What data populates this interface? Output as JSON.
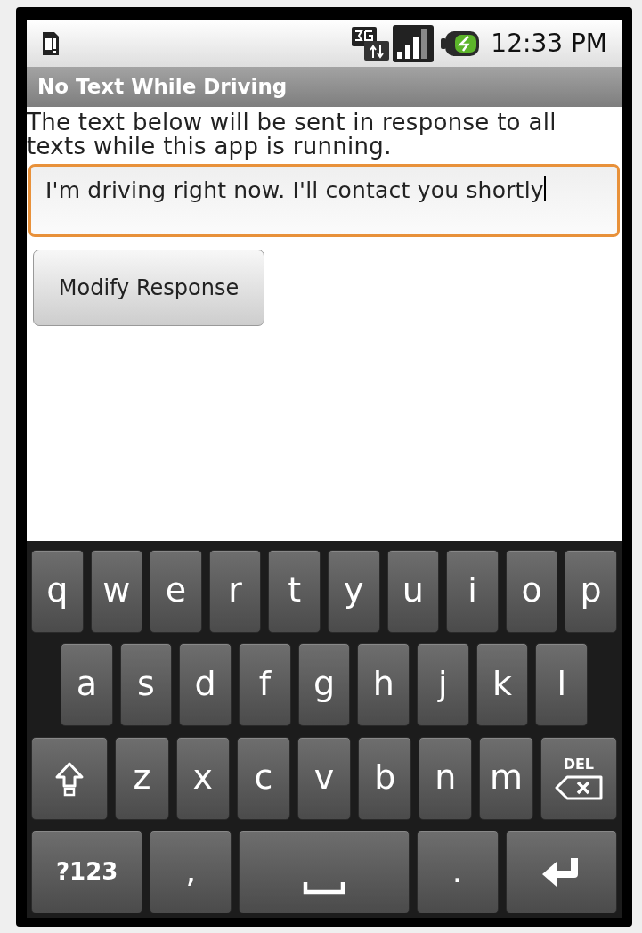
{
  "status_bar": {
    "time": "12:33 PM"
  },
  "title_bar": {
    "title": "No Text While Driving"
  },
  "content": {
    "instructions": "The text below will be sent in response to all texts while this app is running.",
    "response_field": {
      "value": "I'm driving right now. I'll contact you shortly",
      "focused": true
    },
    "buttons": [
      {
        "label": "Modify Response"
      }
    ]
  },
  "keyboard": {
    "rows": [
      {
        "keys": [
          {
            "kind": "letter",
            "label": "q"
          },
          {
            "kind": "letter",
            "label": "w"
          },
          {
            "kind": "letter",
            "label": "e"
          },
          {
            "kind": "letter",
            "label": "r"
          },
          {
            "kind": "letter",
            "label": "t"
          },
          {
            "kind": "letter",
            "label": "y"
          },
          {
            "kind": "letter",
            "label": "u"
          },
          {
            "kind": "letter",
            "label": "i"
          },
          {
            "kind": "letter",
            "label": "o"
          },
          {
            "kind": "letter",
            "label": "p"
          }
        ]
      },
      {
        "keys": [
          {
            "kind": "letter",
            "label": "a"
          },
          {
            "kind": "letter",
            "label": "s"
          },
          {
            "kind": "letter",
            "label": "d"
          },
          {
            "kind": "letter",
            "label": "f"
          },
          {
            "kind": "letter",
            "label": "g"
          },
          {
            "kind": "letter",
            "label": "h"
          },
          {
            "kind": "letter",
            "label": "j"
          },
          {
            "kind": "letter",
            "label": "k"
          },
          {
            "kind": "letter",
            "label": "l"
          }
        ]
      },
      {
        "keys": [
          {
            "kind": "shift"
          },
          {
            "kind": "letter",
            "label": "z"
          },
          {
            "kind": "letter",
            "label": "x"
          },
          {
            "kind": "letter",
            "label": "c"
          },
          {
            "kind": "letter",
            "label": "v"
          },
          {
            "kind": "letter",
            "label": "b"
          },
          {
            "kind": "letter",
            "label": "n"
          },
          {
            "kind": "letter",
            "label": "m"
          },
          {
            "kind": "delete",
            "label": "DEL"
          }
        ]
      },
      {
        "keys": [
          {
            "kind": "symbols",
            "label": "?123"
          },
          {
            "kind": "letter",
            "label": ","
          },
          {
            "kind": "space"
          },
          {
            "kind": "letter",
            "label": "."
          },
          {
            "kind": "enter"
          }
        ]
      }
    ]
  }
}
